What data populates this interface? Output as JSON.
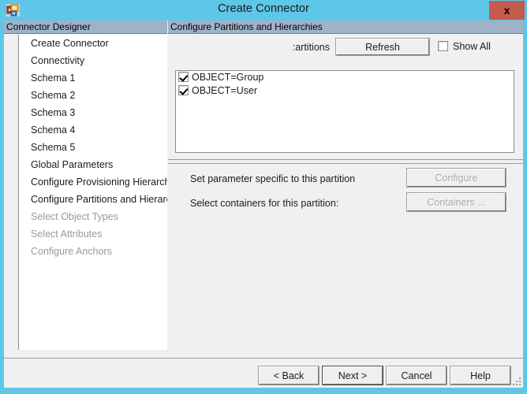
{
  "window": {
    "title": "Create Connector",
    "icon": "connector-app-icon",
    "close_label": "x",
    "titlebar_color": "#5ec6e8",
    "close_button_color": "#c35b4f",
    "header_band_color": "#9fb2c8"
  },
  "sidebar": {
    "header": "Connector Designer",
    "items": [
      {
        "label": "Create Connector",
        "state": "enabled",
        "current": false
      },
      {
        "label": "Connectivity",
        "state": "enabled",
        "current": false
      },
      {
        "label": "Schema 1",
        "state": "enabled",
        "current": false
      },
      {
        "label": "Schema 2",
        "state": "enabled",
        "current": false
      },
      {
        "label": "Schema 3",
        "state": "enabled",
        "current": false
      },
      {
        "label": "Schema 4",
        "state": "enabled",
        "current": false
      },
      {
        "label": "Schema 5",
        "state": "enabled",
        "current": false
      },
      {
        "label": "Global Parameters",
        "state": "enabled",
        "current": false
      },
      {
        "label": "Configure Provisioning Hierarchy",
        "state": "enabled",
        "current": false
      },
      {
        "label": "Configure Partitions and Hierarchies",
        "state": "enabled",
        "current": true
      },
      {
        "label": "Select Object Types",
        "state": "disabled",
        "current": false
      },
      {
        "label": "Select Attributes",
        "state": "disabled",
        "current": false
      },
      {
        "label": "Configure Anchors",
        "state": "disabled",
        "current": false
      }
    ],
    "current_marker": "⇒"
  },
  "main": {
    "header": "Configure Partitions and Hierarchies",
    "partitions_label": "artitions:",
    "refresh_label": "Refresh",
    "show_all_label": "Show All",
    "show_all_checked": false,
    "partitions": [
      {
        "label": "OBJECT=Group",
        "checked": true
      },
      {
        "label": "OBJECT=User",
        "checked": true
      }
    ],
    "parameter_row_label": "Set parameter specific to this partition",
    "configure_label": "Configure",
    "configure_enabled": false,
    "containers_row_label": "Select containers for this partition:",
    "containers_label": "Containers ...",
    "containers_enabled": false
  },
  "footer": {
    "back_label": "< Back",
    "next_label": "Next >",
    "cancel_label": "Cancel",
    "help_label": "Help"
  }
}
